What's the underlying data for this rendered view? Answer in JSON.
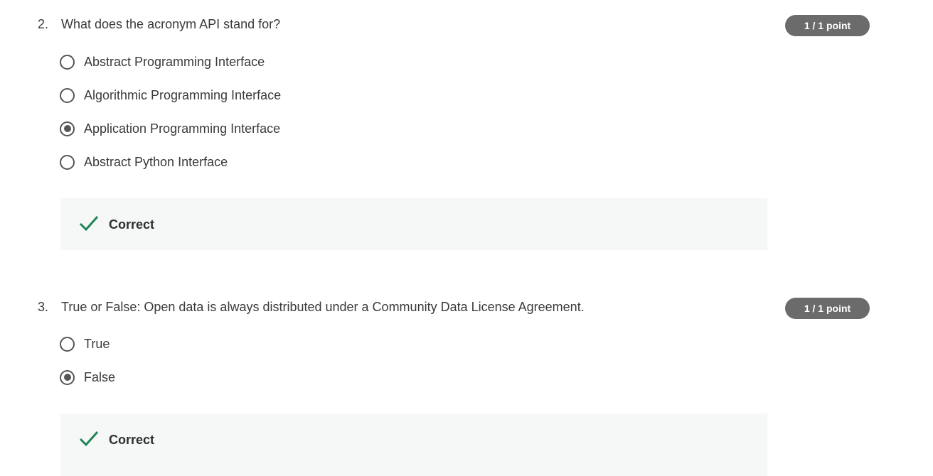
{
  "questions": [
    {
      "number": "2.",
      "text": "What does the acronym API stand for?",
      "score": "1 / 1 point",
      "options": [
        {
          "label": "Abstract Programming Interface",
          "selected": false
        },
        {
          "label": "Algorithmic Programming Interface",
          "selected": false
        },
        {
          "label": "Application Programming Interface",
          "selected": true
        },
        {
          "label": "Abstract Python Interface",
          "selected": false
        }
      ],
      "feedback": "Correct"
    },
    {
      "number": "3.",
      "text": "True or False: Open data is always distributed under a Community Data License Agreement.",
      "score": "1 / 1 point",
      "options": [
        {
          "label": "True",
          "selected": false
        },
        {
          "label": "False",
          "selected": true
        }
      ],
      "feedback": "Correct"
    }
  ],
  "colors": {
    "badge": "#6b6b6b",
    "check": "#1f8354",
    "feedback_bg": "#f5f8f7",
    "radio": "#555555"
  },
  "icons": {
    "check": "checkmark-icon",
    "radio_unselected": "radio-unchecked-icon",
    "radio_selected": "radio-checked-icon"
  }
}
